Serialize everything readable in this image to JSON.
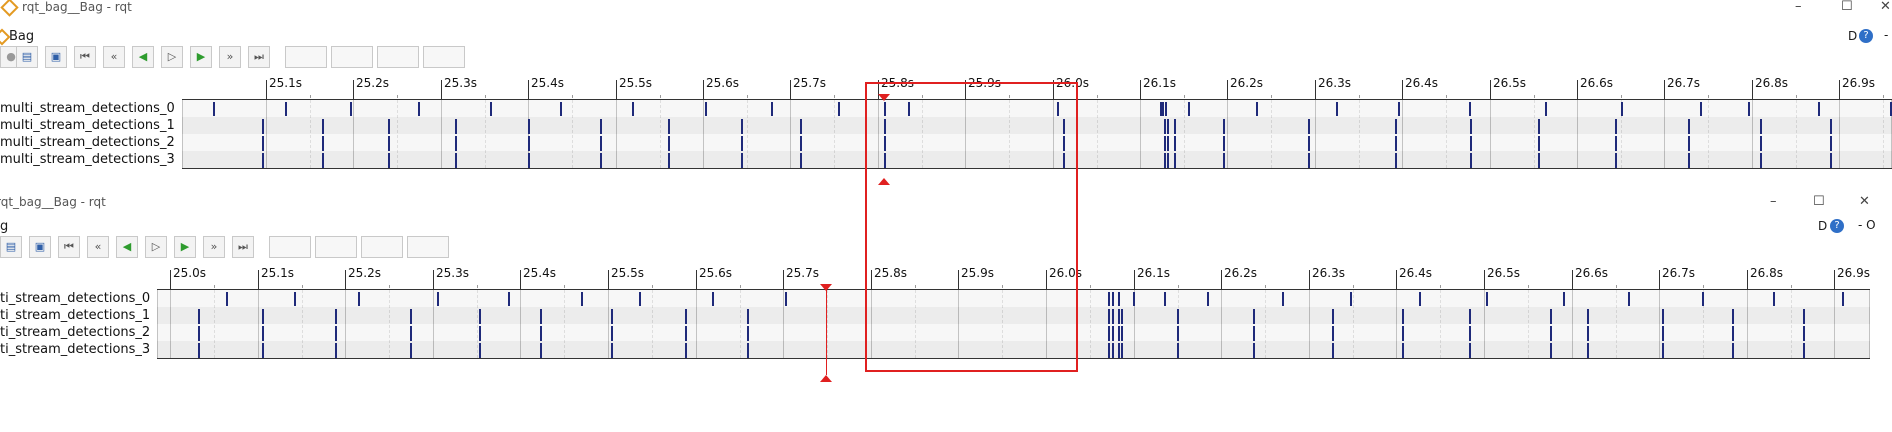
{
  "top_window": {
    "title": "rqt_bag__Bag - rqt",
    "controls": [
      "–",
      "☐",
      "✕"
    ],
    "menu_label": "Bag",
    "dock_label": "D",
    "help_glyph": "?",
    "extra_glyph": "-"
  },
  "bottom_window": {
    "title": "rqt_bag__Bag - rqt",
    "controls": [
      "–",
      "☐",
      "✕"
    ],
    "menu_label": "g",
    "dock_label": "D",
    "help_glyph": "?",
    "extra_glyph": "- O"
  },
  "toolbar_icons": [
    "record-icon",
    "save-icon",
    "load-icon",
    "begin-icon",
    "rewind-icon",
    "back-icon",
    "play-icon",
    "forward-icon",
    "fastforward-icon",
    "end-icon"
  ],
  "top_timeline": {
    "ticks": [
      "25.1s",
      "25.2s",
      "25.3s",
      "25.4s",
      "25.5s",
      "25.6s",
      "25.7s",
      "25.8s",
      "25.9s",
      "26.0s",
      "26.1s",
      "26.2s",
      "26.3s",
      "26.4s",
      "26.5s",
      "26.6s",
      "26.7s",
      "26.8s",
      "26.9s"
    ],
    "topics": [
      "multi_stream_detections_0",
      "multi_stream_detections_1",
      "multi_stream_detections_2",
      "multi_stream_detections_3"
    ]
  },
  "bottom_timeline": {
    "ticks": [
      "25.0s",
      "25.1s",
      "25.2s",
      "25.3s",
      "25.4s",
      "25.5s",
      "25.6s",
      "25.7s",
      "25.8s",
      "25.9s",
      "26.0s",
      "26.1s",
      "26.2s",
      "26.3s",
      "26.4s",
      "26.5s",
      "26.6s",
      "26.7s",
      "26.8s",
      "26.9s"
    ],
    "topics": [
      "ti_stream_detections_0",
      "ti_stream_detections_1",
      "ti_stream_detections_2",
      "ti_stream_detections_3"
    ]
  },
  "colors": {
    "accent_red": "#e02020",
    "message_mark": "#1f2a7a",
    "row_light": "#f4f4f4",
    "row_dark": "#e6e6e6"
  }
}
